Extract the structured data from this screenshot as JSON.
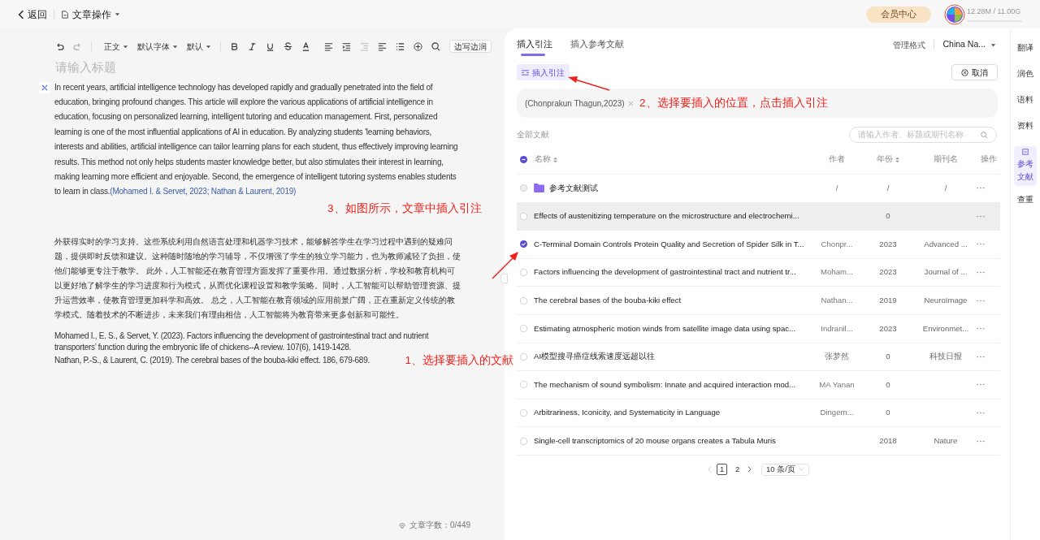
{
  "topbar": {
    "back": "返回",
    "doc_menu": "文章操作",
    "member_button": "会员中心",
    "storage": {
      "text": "12.28M / 11.00G",
      "level": 0.001
    }
  },
  "editor": {
    "toolbar": {
      "style": "正文",
      "font": "默认字体",
      "size": "默认",
      "side_button": "边写边润"
    },
    "title_placeholder": "请输入标题",
    "paragraph": {
      "text": "In recent years, artificial intelligence technology has developed rapidly and gradually penetrated into the field of education, bringing profound changes. This article will explore the various applications of artificial intelligence in education, focusing on personalized learning, intelligent tutoring and education management. First, personalized learning is one of the most influential applications of AI in education. By analyzing students 'learning behaviors, interests and abilities, artificial intelligence can tailor learning plans for each student, thus effectively improving learning results. This method not only helps students master knowledge better, but also stimulates their interest in learning, making learning more efficient and enjoyable. Second, the emergence of intelligent tutoring systems enables students to learn in class.",
      "citation": "(Mohamed I. & Servet, 2023; Nathan & Laurent, 2019)"
    },
    "chinese_paragraph": "外获得实时的学习支持。这些系统利用自然语言处理和机器学习技术，能够解答学生在学习过程中遇到的疑难问题，提供即时反馈和建议。这种随时随地的学习辅导，不仅增强了学生的独立学习能力，也为教师减轻了负担，使他们能够更专注于教学。 此外，人工智能还在教育管理方面发挥了重要作用。通过数据分析，学校和教育机构可以更好地了解学生的学习进度和行为模式，从而优化课程设置和教学策略。同时，人工智能可以帮助管理资源、提升运营效率，使教育管理更加科学和高效。 总之，人工智能在教育领域的应用前景广阔，正在重新定义传统的教学模式。随着技术的不断进步，未来我们有理由相信，人工智能将为教育带来更多创新和可能性。",
    "references": [
      "Mohamed I., E. S., & Servet, Y. (2023). Factors influencing the development of gastrointestinal tract and nutrient transporters’ function during the embryonic life of chickens--A review. 107(6), 1419-1428.",
      "Nathan, P.-S., & Laurent, C. (2019). The cerebral bases of the bouba-kiki effect. 186, 679-689."
    ],
    "word_count": "文章字数：0/449"
  },
  "panel": {
    "tabs": [
      {
        "label": "插入引注",
        "selected": true
      },
      {
        "label": "插入参考文献",
        "selected": false
      }
    ],
    "format_label": "管理格式",
    "format_value": "China Na...",
    "insert_button": "插入引注",
    "cancel_button": "取消",
    "selected_citation": "(Chonprakun Thagun,2023)",
    "section_label": "全部文献",
    "search_placeholder": "请输入作者、标题或期刊名称",
    "select_all_indeterminate": true,
    "columns": [
      "名称",
      "作者",
      "年份",
      "期刊名",
      "操作"
    ],
    "rows": [
      {
        "kind": "folder",
        "name": "参考文献测试",
        "author": "/",
        "year": "/",
        "journal": "/",
        "selected": false,
        "hovered": false
      },
      {
        "kind": "item",
        "name": "Effects of austenitizing temperature on the microstructure and electrochemi...",
        "year": "0",
        "selected": false,
        "hovered": true
      },
      {
        "kind": "item",
        "name": "C-Terminal Domain Controls Protein Quality and Secretion of Spider Silk in T...",
        "author": "Chonpr...",
        "year": "2023",
        "journal": "Advanced ...",
        "selected": true,
        "hovered": false
      },
      {
        "kind": "item",
        "name": "Factors influencing the development of gastrointestinal tract and nutrient tr...",
        "author": "Moham...",
        "year": "2023",
        "journal": "Journal of ...",
        "selected": false,
        "hovered": false
      },
      {
        "kind": "item",
        "name": "The cerebral bases of the bouba-kiki effect",
        "author": "Nathan...",
        "year": "2019",
        "journal": "NeuroImage",
        "selected": false,
        "hovered": false
      },
      {
        "kind": "item",
        "name": "Estimating atmospheric motion winds from satellite image data using spac...",
        "author": "Indranil...",
        "year": "2023",
        "journal": "Environmet...",
        "selected": false,
        "hovered": false
      },
      {
        "kind": "item",
        "name": "AI模型搜寻癌症线索速度远超以往",
        "author": "张梦然",
        "year": "0",
        "journal": "科技日报",
        "selected": false,
        "hovered": false
      },
      {
        "kind": "item",
        "name": "The mechanism of sound symbolism: Innate and acquired interaction mod...",
        "author": "MA Yanan",
        "year": "0",
        "selected": false,
        "hovered": false
      },
      {
        "kind": "item",
        "name": "Arbitrariness, Iconicity, and Systematicity in Language",
        "author": "Dingem...",
        "year": "0",
        "selected": false,
        "hovered": false
      },
      {
        "kind": "item",
        "name": "Single-cell transcriptomics of 20 mouse organs creates a Tabula Muris",
        "year": "2018",
        "journal": "Nature",
        "selected": false,
        "hovered": false
      }
    ],
    "pagination": {
      "pages": [
        {
          "label": "1",
          "selected": true
        },
        {
          "label": "2",
          "selected": false
        }
      ],
      "page_size": "10 条/页"
    }
  },
  "sidebar": {
    "items": [
      {
        "label": "翻译",
        "selected": false
      },
      {
        "label": "润色",
        "selected": false
      },
      {
        "label": "语料",
        "selected": false
      },
      {
        "label": "资料",
        "selected": false
      },
      {
        "label": "参考文献",
        "selected": true
      },
      {
        "label": "查重",
        "selected": false
      }
    ]
  },
  "annotations": [
    "1、选择要插入的文献",
    "2、选择要插入的位置，点击插入引注",
    "3、如图所示，文章中插入引注"
  ]
}
